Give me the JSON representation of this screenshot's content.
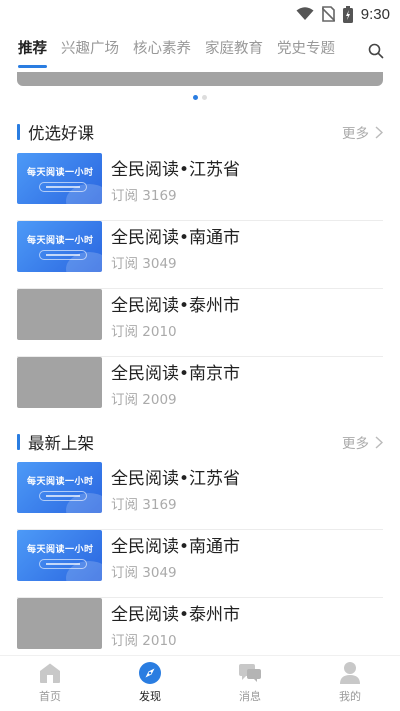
{
  "status": {
    "time": "9:30"
  },
  "tabs": [
    {
      "label": "推荐",
      "active": true
    },
    {
      "label": "兴趣广场",
      "active": false
    },
    {
      "label": "核心素养",
      "active": false
    },
    {
      "label": "家庭教育",
      "active": false
    },
    {
      "label": "党史专题",
      "active": false
    }
  ],
  "sections": [
    {
      "title": "优选好课",
      "more": "更多",
      "items": [
        {
          "title": "全民阅读•江苏省",
          "subs": "订阅 3169",
          "thumb": "blue"
        },
        {
          "title": "全民阅读•南通市",
          "subs": "订阅 3049",
          "thumb": "blue"
        },
        {
          "title": " 全民阅读•泰州市",
          "subs": "订阅 2010",
          "thumb": "gray"
        },
        {
          "title": "全民阅读•南京市",
          "subs": "订阅 2009",
          "thumb": "gray"
        }
      ]
    },
    {
      "title": "最新上架",
      "more": "更多",
      "items": [
        {
          "title": "全民阅读•江苏省",
          "subs": "订阅 3169",
          "thumb": "blue"
        },
        {
          "title": "全民阅读•南通市",
          "subs": "订阅 3049",
          "thumb": "blue"
        },
        {
          "title": " 全民阅读•泰州市",
          "subs": "订阅 2010",
          "thumb": "gray"
        }
      ]
    }
  ],
  "thumb_text": {
    "line1": "每天阅读一小时"
  },
  "nav": [
    {
      "label": "首页",
      "icon": "home-icon",
      "active": false
    },
    {
      "label": "发现",
      "icon": "compass-icon",
      "active": true
    },
    {
      "label": "消息",
      "icon": "message-icon",
      "active": false
    },
    {
      "label": "我的",
      "icon": "profile-icon",
      "active": false
    }
  ],
  "colors": {
    "accent": "#2a7de1",
    "placeholder": "#a3a3a3",
    "muted": "#999999"
  }
}
